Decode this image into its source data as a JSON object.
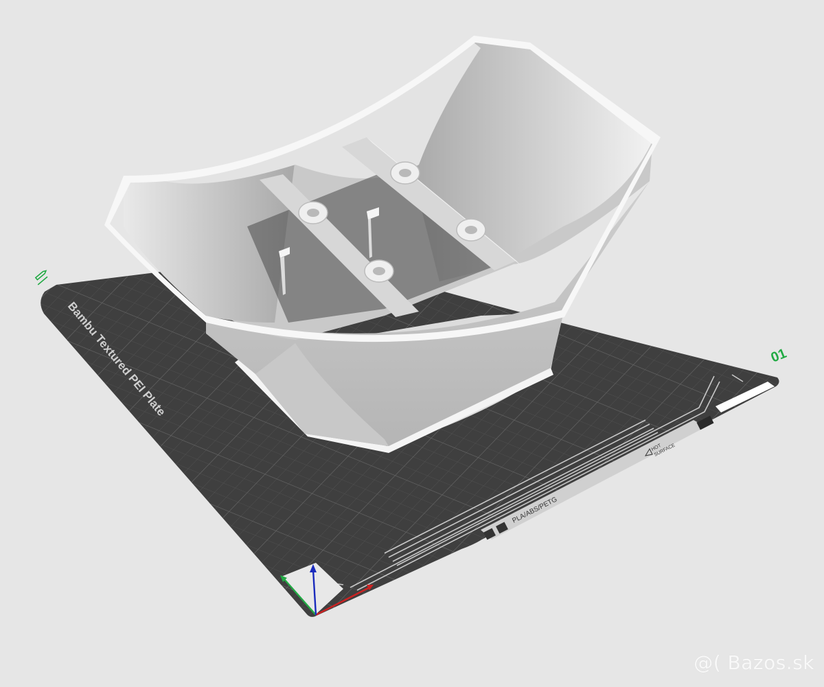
{
  "viewport": {
    "plate_name": "Bambu Textured PEI Plate",
    "plate_number": "01",
    "filament_label": "PLA/ABS/PETG",
    "warning_line1": "HOT",
    "warning_line2": "SURFACE",
    "object": "printed-bowl-part"
  },
  "watermark": "@( Bazos.sk",
  "colors": {
    "background": "#e6e6e6",
    "plate": "#3f3f3f",
    "plate_text": "#cfcfcf",
    "plate_number": "#22aa44",
    "axis_x": "#cc2222",
    "axis_y": "#22aa44",
    "axis_z": "#1a2bbd",
    "model": "#d8d8d8"
  },
  "icons": [
    "edit-pen-icon",
    "axis-gizmo-icon",
    "hot-surface-warning-icon",
    "plate-logo-icon"
  ]
}
